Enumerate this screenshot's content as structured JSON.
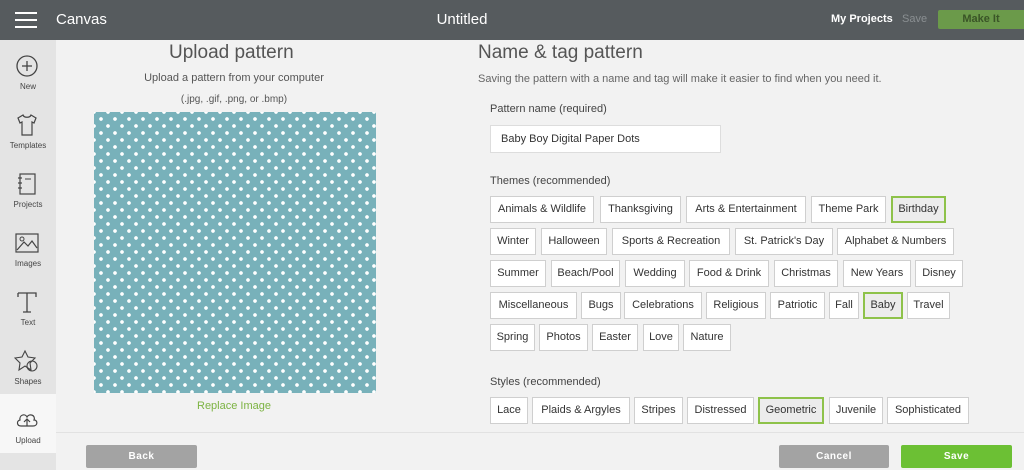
{
  "header": {
    "app_title": "Canvas",
    "doc_title": "Untitled",
    "my_projects": "My Projects",
    "save": "Save",
    "make_it": "Make It"
  },
  "sidebar": {
    "items": [
      {
        "label": "New",
        "icon": "plus-circle-icon"
      },
      {
        "label": "Templates",
        "icon": "tshirt-icon"
      },
      {
        "label": "Projects",
        "icon": "notebook-icon"
      },
      {
        "label": "Images",
        "icon": "image-icon"
      },
      {
        "label": "Text",
        "icon": "text-t-icon"
      },
      {
        "label": "Shapes",
        "icon": "shapes-icon"
      },
      {
        "label": "Upload",
        "icon": "cloud-upload-icon"
      }
    ]
  },
  "upload": {
    "title": "Upload pattern",
    "subtitle": "Upload a pattern from your computer",
    "formats": "(.jpg, .gif, .png, or .bmp)",
    "replace": "Replace Image"
  },
  "name_tag": {
    "title": "Name & tag pattern",
    "subtitle": "Saving the pattern with a name and tag will make it easier to find when you need it.",
    "name_label": "Pattern name (required)",
    "name_value": "Baby Boy Digital Paper Dots",
    "themes_label": "Themes (recommended)",
    "styles_label": "Styles (recommended)"
  },
  "themes": [
    {
      "label": "Animals & Wildlife",
      "selected": false
    },
    {
      "label": "Thanksgiving",
      "selected": false
    },
    {
      "label": "Arts & Entertainment",
      "selected": false
    },
    {
      "label": "Theme Park",
      "selected": false
    },
    {
      "label": "Birthday",
      "selected": true
    },
    {
      "label": "Winter",
      "selected": false
    },
    {
      "label": "Halloween",
      "selected": false
    },
    {
      "label": "Sports & Recreation",
      "selected": false
    },
    {
      "label": "St. Patrick's Day",
      "selected": false
    },
    {
      "label": "Alphabet & Numbers",
      "selected": false
    },
    {
      "label": "Summer",
      "selected": false
    },
    {
      "label": "Beach/Pool",
      "selected": false
    },
    {
      "label": "Wedding",
      "selected": false
    },
    {
      "label": "Food & Drink",
      "selected": false
    },
    {
      "label": "Christmas",
      "selected": false
    },
    {
      "label": "New Years",
      "selected": false
    },
    {
      "label": "Disney",
      "selected": false
    },
    {
      "label": "Miscellaneous",
      "selected": false
    },
    {
      "label": "Bugs",
      "selected": false
    },
    {
      "label": "Celebrations",
      "selected": false
    },
    {
      "label": "Religious",
      "selected": false
    },
    {
      "label": "Patriotic",
      "selected": false
    },
    {
      "label": "Fall",
      "selected": false
    },
    {
      "label": "Baby",
      "selected": true
    },
    {
      "label": "Travel",
      "selected": false
    },
    {
      "label": "Spring",
      "selected": false
    },
    {
      "label": "Photos",
      "selected": false
    },
    {
      "label": "Easter",
      "selected": false
    },
    {
      "label": "Love",
      "selected": false
    },
    {
      "label": "Nature",
      "selected": false
    }
  ],
  "styles": [
    {
      "label": "Lace",
      "selected": false
    },
    {
      "label": "Plaids & Argyles",
      "selected": false
    },
    {
      "label": "Stripes",
      "selected": false
    },
    {
      "label": "Distressed",
      "selected": false
    },
    {
      "label": "Geometric",
      "selected": true
    },
    {
      "label": "Juvenile",
      "selected": false
    },
    {
      "label": "Sophisticated",
      "selected": false
    }
  ],
  "footer": {
    "back": "Back",
    "cancel": "Cancel",
    "save": "Save"
  },
  "colors": {
    "topbar": "#565b5e",
    "accent_green": "#6cc034",
    "selected_border": "#8ec24a",
    "pattern_bg": "#78b1ba",
    "pattern_dot": "#ffffff"
  }
}
